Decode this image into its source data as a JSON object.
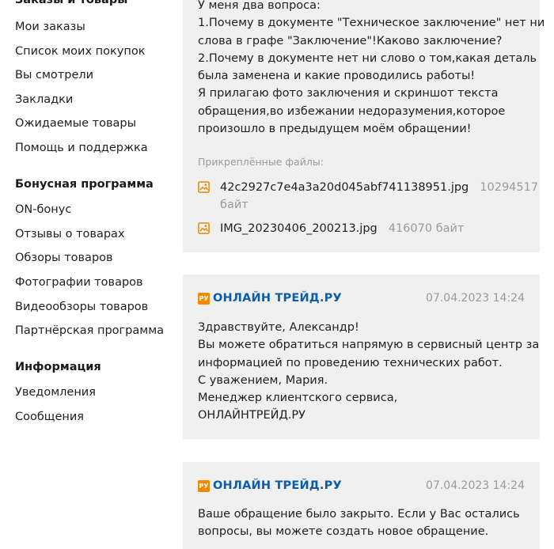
{
  "sidebar": {
    "section1_title": "Заказы и товары",
    "section1_items": [
      {
        "label": "Мои заказы"
      },
      {
        "label": "Список моих покупок"
      },
      {
        "label": "Вы смотрели"
      },
      {
        "label": "Закладки"
      },
      {
        "label": "Ожидаемые товары"
      },
      {
        "label": "Помощь и поддержка"
      }
    ],
    "section2_title": "Бонусная программа",
    "section2_items": [
      {
        "label": "ON-бонус"
      },
      {
        "label": "Отзывы о товарах"
      },
      {
        "label": "Обзоры товаров"
      },
      {
        "label": "Фотографии товаров"
      },
      {
        "label": "Видеообзоры товаров"
      },
      {
        "label": "Партнёрская программа"
      }
    ],
    "section3_title": "Информация",
    "section3_items": [
      {
        "label": "Уведомления"
      },
      {
        "label": "Сообщения"
      }
    ]
  },
  "messages": [
    {
      "lines": [
        "У меня два вопроса:",
        "1.Почему в документе \"Техническое заключение\" нет ни",
        "слова в графе \"Заключение\"!Каково заключение?",
        "2.Почему в документе нет ни слово о том,какая деталь",
        "была заменена и какие проводились работы!",
        "Я прилагаю фото заключения и скриншот текста",
        "обращения,во избежании недоразумения,которое",
        "произошло в предыдущем моём обращении!"
      ],
      "attachments_label": "Прикреплённые файлы:",
      "attachments": [
        {
          "name": "42c2927c7e4a3a20d045abf741138951.jpg",
          "size_line1": "10294517",
          "size_line2": "байт",
          "icon": "image-file-icon"
        },
        {
          "name": "IMG_20230406_200213.jpg",
          "size": "416070 байт",
          "icon": "image-file-icon"
        }
      ]
    },
    {
      "sender": "ОНЛАЙН ТРЕЙД.РУ",
      "badge": "РУ",
      "date": "07.04.2023 14:24",
      "lines": [
        "Здравствуйте, Александр!",
        "Вы можете обратиться напрямую в сервисный центр за",
        "информацией по проведению технических работ.",
        "С уважением, Мария.",
        "Менеджер клиентского сервиса,",
        "ОНЛАЙНТРЕЙД.РУ"
      ]
    },
    {
      "sender": "ОНЛАЙН ТРЕЙД.РУ",
      "badge": "РУ",
      "date": "07.04.2023 14:24",
      "lines": [
        "Ваше обращение было закрыто. Если у Вас остались",
        "вопросы, вы можете создать новое обращение."
      ]
    }
  ],
  "colors": {
    "card_bg": "#f0f0f0",
    "brand_blue": "#0b5da8",
    "brand_orange": "#f28a00",
    "muted": "#9a9a9a"
  }
}
